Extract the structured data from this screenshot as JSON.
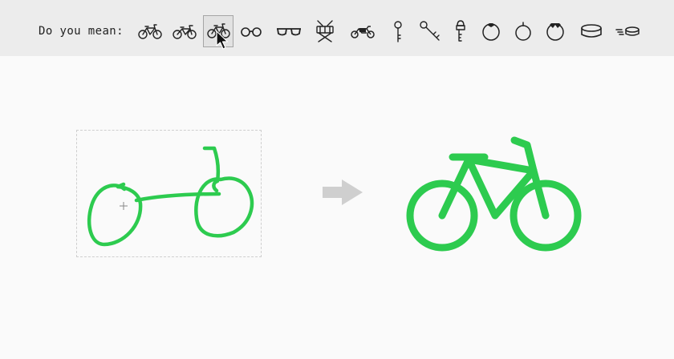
{
  "toolbar": {
    "prompt_label": "Do you mean:",
    "suggestions": [
      {
        "icon": "bicycle-icon-1"
      },
      {
        "icon": "bicycle-icon-2"
      },
      {
        "icon": "bicycle-icon-3",
        "selected": true
      },
      {
        "icon": "round-glasses-icon"
      },
      {
        "icon": "sunglasses-icon"
      },
      {
        "icon": "drum-icon"
      },
      {
        "icon": "motorcycle-icon"
      },
      {
        "icon": "key-icon-1"
      },
      {
        "icon": "key-icon-2"
      },
      {
        "icon": "key-icon-3"
      },
      {
        "icon": "fruit-icon-1"
      },
      {
        "icon": "fruit-icon-2"
      },
      {
        "icon": "fruit-icon-3"
      },
      {
        "icon": "hockey-puck-icon"
      },
      {
        "icon": "moving-puck-icon"
      }
    ]
  },
  "colors": {
    "stroke": "#2dcb4f",
    "toolbar_bg": "#ececec",
    "page_bg": "#fafafa",
    "arrow": "#cfcfcf",
    "icon": "#222222"
  }
}
